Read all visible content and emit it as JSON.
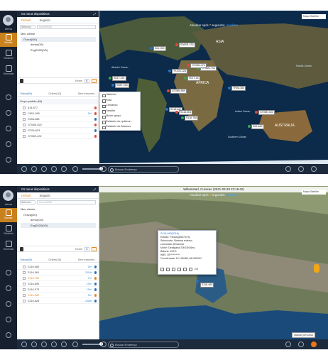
{
  "user": {
    "name": "demo"
  },
  "nav": [
    {
      "label": "Monitor",
      "active": true
    },
    {
      "label": "Relatório",
      "active": false
    },
    {
      "label": "Gerenciar",
      "active": false
    }
  ],
  "panel": {
    "title": "Os meus dispositivos",
    "tabs": {
      "default": "Default",
      "following": "Seguido"
    },
    "search": {
      "select": "Selecion",
      "placeholder": "Nome/IMEI"
    },
    "tree": {
      "root": "Meu cliente",
      "account": "iTrack(0/0)",
      "sub1": "demo(0/0)",
      "sub2": "Eng2020(0/0)"
    },
    "filter": {
      "label": "Nome",
      "box1": "K",
      "box2": "T"
    },
    "device_tabs": {
      "all_1": "Todos(66)",
      "all_2": "Todos(58)",
      "online_1": "Online(43)",
      "online_2": "Online(45)",
      "notx": "Sem transmis..."
    },
    "group1": "Grupo padrão (66)"
  },
  "devices_1": [
    {
      "name": "814-877",
      "speed": "",
      "color": "#e04a3a"
    },
    {
      "name": "C801-089",
      "speed": "0h+",
      "color": "#e04a3a"
    },
    {
      "name": "S156-088",
      "speed": "",
      "color": "#2b6fb8"
    },
    {
      "name": "GT06N-822",
      "speed": "",
      "color": "#e04a3a"
    },
    {
      "name": "GT06-823",
      "speed": "",
      "color": "#2b6fb8"
    },
    {
      "name": "GT06E-402",
      "speed": "",
      "color": "#e04a3a"
    }
  ],
  "devices_2": [
    {
      "name": "S116-460",
      "speed": "0h+",
      "color": "#2b6fb8"
    },
    {
      "name": "S116-561",
      "speed": "2014h",
      "color": "#2b6fb8"
    },
    {
      "name": "S116-780",
      "speed": "7h+",
      "color": "#e2891f"
    },
    {
      "name": "S116-893",
      "speed": "10h+",
      "color": "#2b6fb8"
    },
    {
      "name": "S116-973",
      "speed": "10h+",
      "color": "#2b6fb8"
    },
    {
      "name": "S116-282",
      "speed": "0h+",
      "color": "#e2891f"
    },
    {
      "name": "S116-828",
      "speed": "2016h",
      "color": "#2b6fb8"
    }
  ],
  "context_menu": [
    "Histórico",
    "Rota",
    "Comando",
    "Detalhe",
    "Mover grupo",
    "Relatório de quilome...",
    "Relatório de Alarmes"
  ],
  "map1": {
    "refresh_prefix": "Atualizar após",
    "refresh_seconds": "7",
    "refresh_unit": "segundos.",
    "refresh_link": "Atualizar",
    "map_type": "Mapa  Satélite",
    "labels": [
      "ASIA",
      "AFRICA",
      "AUSTRALIA",
      "Atlantic Ocean",
      "Indian Ocean",
      "Pacific Ocean",
      "Southern Ocean"
    ],
    "markers": [
      "S01-000",
      "S08SR-230",
      "GT06N-734",
      "TK103-12A",
      "GT06N-470",
      "S01T-241",
      "S08T-018",
      "GT06N-589",
      "S01T-44",
      "TR06-184",
      "GT06E-402",
      "S09-669",
      "S116-460",
      "S116-561",
      "S116-788"
    ]
  },
  "map2": {
    "place": "Willemstad, Curacao",
    "date": "(2021-03-29 23:19:42)",
    "refresh_seconds": "6",
    "popup": {
      "title": "S116-460(S116)",
      "estado": "Estado: Parado(65h7m7s)",
      "selecionar": "Selecionar: Sistema externo",
      "conectado": "conectado Desarmar",
      "motor": "Motor: Desligado(70h23h36m)",
      "bateria": "Bateria: 100%",
      "imei": "IMEI: 35**********",
      "coord": "Coordenada: 12.196480,-68.939091",
      "page": "2/3"
    },
    "markers": [
      "S116-460"
    ],
    "baixar": "Baixar percurso"
  },
  "bottom": {
    "address_placeholder": "Buscar Endereço"
  }
}
